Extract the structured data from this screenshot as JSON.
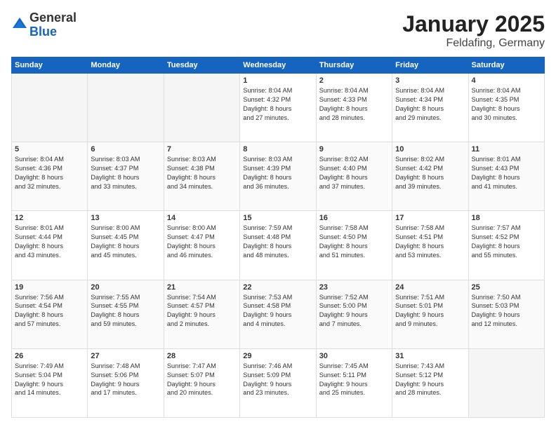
{
  "header": {
    "logo_general": "General",
    "logo_blue": "Blue",
    "title": "January 2025",
    "subtitle": "Feldafing, Germany"
  },
  "calendar": {
    "days_of_week": [
      "Sunday",
      "Monday",
      "Tuesday",
      "Wednesday",
      "Thursday",
      "Friday",
      "Saturday"
    ],
    "weeks": [
      [
        {
          "day": "",
          "info": ""
        },
        {
          "day": "",
          "info": ""
        },
        {
          "day": "",
          "info": ""
        },
        {
          "day": "1",
          "info": "Sunrise: 8:04 AM\nSunset: 4:32 PM\nDaylight: 8 hours\nand 27 minutes."
        },
        {
          "day": "2",
          "info": "Sunrise: 8:04 AM\nSunset: 4:33 PM\nDaylight: 8 hours\nand 28 minutes."
        },
        {
          "day": "3",
          "info": "Sunrise: 8:04 AM\nSunset: 4:34 PM\nDaylight: 8 hours\nand 29 minutes."
        },
        {
          "day": "4",
          "info": "Sunrise: 8:04 AM\nSunset: 4:35 PM\nDaylight: 8 hours\nand 30 minutes."
        }
      ],
      [
        {
          "day": "5",
          "info": "Sunrise: 8:04 AM\nSunset: 4:36 PM\nDaylight: 8 hours\nand 32 minutes."
        },
        {
          "day": "6",
          "info": "Sunrise: 8:03 AM\nSunset: 4:37 PM\nDaylight: 8 hours\nand 33 minutes."
        },
        {
          "day": "7",
          "info": "Sunrise: 8:03 AM\nSunset: 4:38 PM\nDaylight: 8 hours\nand 34 minutes."
        },
        {
          "day": "8",
          "info": "Sunrise: 8:03 AM\nSunset: 4:39 PM\nDaylight: 8 hours\nand 36 minutes."
        },
        {
          "day": "9",
          "info": "Sunrise: 8:02 AM\nSunset: 4:40 PM\nDaylight: 8 hours\nand 37 minutes."
        },
        {
          "day": "10",
          "info": "Sunrise: 8:02 AM\nSunset: 4:42 PM\nDaylight: 8 hours\nand 39 minutes."
        },
        {
          "day": "11",
          "info": "Sunrise: 8:01 AM\nSunset: 4:43 PM\nDaylight: 8 hours\nand 41 minutes."
        }
      ],
      [
        {
          "day": "12",
          "info": "Sunrise: 8:01 AM\nSunset: 4:44 PM\nDaylight: 8 hours\nand 43 minutes."
        },
        {
          "day": "13",
          "info": "Sunrise: 8:00 AM\nSunset: 4:45 PM\nDaylight: 8 hours\nand 45 minutes."
        },
        {
          "day": "14",
          "info": "Sunrise: 8:00 AM\nSunset: 4:47 PM\nDaylight: 8 hours\nand 46 minutes."
        },
        {
          "day": "15",
          "info": "Sunrise: 7:59 AM\nSunset: 4:48 PM\nDaylight: 8 hours\nand 48 minutes."
        },
        {
          "day": "16",
          "info": "Sunrise: 7:58 AM\nSunset: 4:50 PM\nDaylight: 8 hours\nand 51 minutes."
        },
        {
          "day": "17",
          "info": "Sunrise: 7:58 AM\nSunset: 4:51 PM\nDaylight: 8 hours\nand 53 minutes."
        },
        {
          "day": "18",
          "info": "Sunrise: 7:57 AM\nSunset: 4:52 PM\nDaylight: 8 hours\nand 55 minutes."
        }
      ],
      [
        {
          "day": "19",
          "info": "Sunrise: 7:56 AM\nSunset: 4:54 PM\nDaylight: 8 hours\nand 57 minutes."
        },
        {
          "day": "20",
          "info": "Sunrise: 7:55 AM\nSunset: 4:55 PM\nDaylight: 8 hours\nand 59 minutes."
        },
        {
          "day": "21",
          "info": "Sunrise: 7:54 AM\nSunset: 4:57 PM\nDaylight: 9 hours\nand 2 minutes."
        },
        {
          "day": "22",
          "info": "Sunrise: 7:53 AM\nSunset: 4:58 PM\nDaylight: 9 hours\nand 4 minutes."
        },
        {
          "day": "23",
          "info": "Sunrise: 7:52 AM\nSunset: 5:00 PM\nDaylight: 9 hours\nand 7 minutes."
        },
        {
          "day": "24",
          "info": "Sunrise: 7:51 AM\nSunset: 5:01 PM\nDaylight: 9 hours\nand 9 minutes."
        },
        {
          "day": "25",
          "info": "Sunrise: 7:50 AM\nSunset: 5:03 PM\nDaylight: 9 hours\nand 12 minutes."
        }
      ],
      [
        {
          "day": "26",
          "info": "Sunrise: 7:49 AM\nSunset: 5:04 PM\nDaylight: 9 hours\nand 14 minutes."
        },
        {
          "day": "27",
          "info": "Sunrise: 7:48 AM\nSunset: 5:06 PM\nDaylight: 9 hours\nand 17 minutes."
        },
        {
          "day": "28",
          "info": "Sunrise: 7:47 AM\nSunset: 5:07 PM\nDaylight: 9 hours\nand 20 minutes."
        },
        {
          "day": "29",
          "info": "Sunrise: 7:46 AM\nSunset: 5:09 PM\nDaylight: 9 hours\nand 23 minutes."
        },
        {
          "day": "30",
          "info": "Sunrise: 7:45 AM\nSunset: 5:11 PM\nDaylight: 9 hours\nand 25 minutes."
        },
        {
          "day": "31",
          "info": "Sunrise: 7:43 AM\nSunset: 5:12 PM\nDaylight: 9 hours\nand 28 minutes."
        },
        {
          "day": "",
          "info": ""
        }
      ]
    ]
  }
}
